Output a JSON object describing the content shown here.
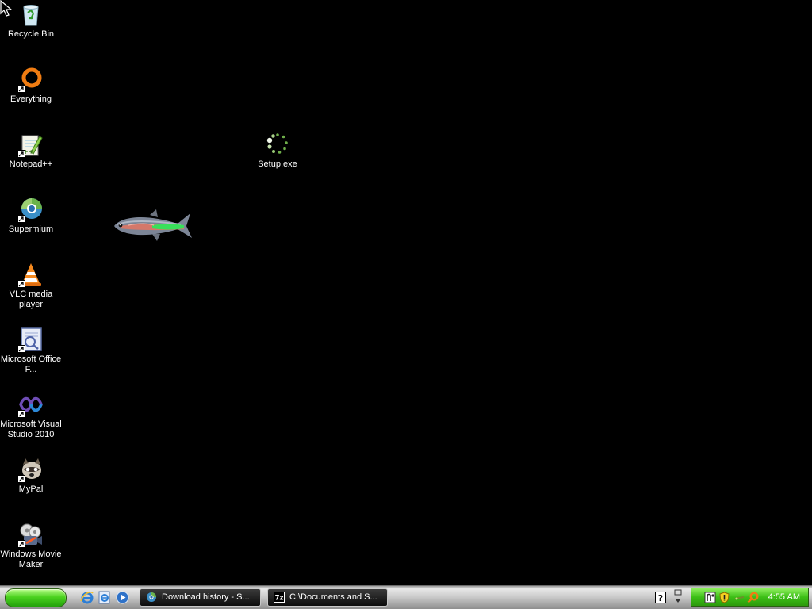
{
  "desktop": {
    "icons": [
      {
        "label": "Recycle Bin",
        "icon": "recycle-bin-icon",
        "shortcut": false
      },
      {
        "label": "Everything",
        "icon": "everything-search-icon",
        "shortcut": true
      },
      {
        "label": "Notepad++",
        "icon": "notepad-plus-plus-icon",
        "shortcut": true
      },
      {
        "label": "Supermium",
        "icon": "supermium-browser-icon",
        "shortcut": true
      },
      {
        "label": "VLC media player",
        "icon": "vlc-cone-icon",
        "shortcut": true
      },
      {
        "label": "Microsoft Office F...",
        "icon": "office-document-icon",
        "shortcut": true
      },
      {
        "label": "Microsoft Visual Studio 2010",
        "icon": "visual-studio-icon",
        "shortcut": true
      },
      {
        "label": "MyPal",
        "icon": "mypal-browser-icon",
        "shortcut": true
      },
      {
        "label": "Windows Movie Maker",
        "icon": "movie-maker-icon",
        "shortcut": true
      },
      {
        "label": "Setup.exe",
        "icon": "setup-loading-icon",
        "shortcut": false
      }
    ]
  },
  "taskbar": {
    "quick_launch": [
      "internet-explorer-icon",
      "ie-page-icon",
      "media-player-icon"
    ],
    "tasks": [
      {
        "label": "Download history - S...",
        "icon": "supermium-browser-icon"
      },
      {
        "label": "C:\\Documents and S...",
        "icon": "seven-zip-icon",
        "icon_text": "7z"
      }
    ],
    "tray_icons": [
      "network-icon",
      "security-shield-icon",
      "tray-tool-icon",
      "search-tray-icon"
    ],
    "clock": "4:55 AM",
    "colors": {
      "start": "#36c01a",
      "tray": "#3cbf16",
      "task_bg": "#1a1a1a"
    }
  }
}
